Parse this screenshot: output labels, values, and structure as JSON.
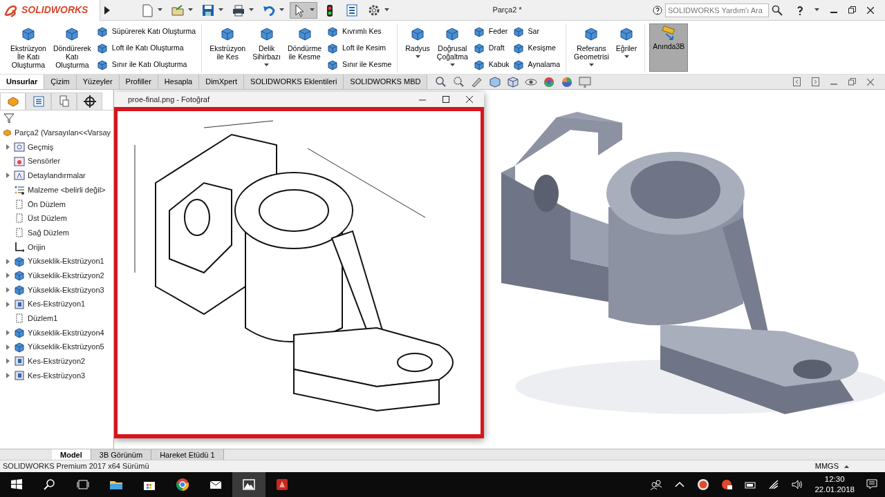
{
  "window": {
    "logo": "SOLIDWORKS",
    "title": "Parça2 *"
  },
  "quick_tools": [
    {
      "kind": "new",
      "pressed": false,
      "dropdown": true
    },
    {
      "kind": "open",
      "pressed": false,
      "dropdown": true
    },
    {
      "kind": "save",
      "pressed": false,
      "dropdown": true
    },
    {
      "kind": "print",
      "pressed": false,
      "dropdown": true
    },
    {
      "kind": "undo",
      "pressed": false,
      "dropdown": true
    },
    {
      "kind": "select",
      "pressed": true,
      "dropdown": true
    },
    {
      "kind": "rebuild",
      "pressed": false,
      "dropdown": false
    },
    {
      "kind": "list",
      "pressed": false,
      "dropdown": false
    },
    {
      "kind": "settings",
      "pressed": false,
      "dropdown": true
    }
  ],
  "help_search": {
    "placeholder": "SOLIDWORKS Yardım'ı Ara"
  },
  "ribbon": [
    {
      "items": [
        {
          "kind": "large",
          "label": "Ekstrüzyon\nİle Katı\nOluşturma",
          "dropdown": false
        },
        {
          "kind": "large",
          "label": "Döndürerek\nKatı\nOluşturma",
          "dropdown": false
        },
        {
          "kind": "stack",
          "items": [
            "Süpürerek Katı Oluşturma",
            "Loft ile Katı Oluşturma",
            "Sınır ile Katı Oluşturma"
          ]
        }
      ]
    },
    {
      "items": [
        {
          "kind": "large",
          "label": "Ekstrüzyon\nile Kes",
          "dropdown": false
        },
        {
          "kind": "large",
          "label": "Delik\nSihirbazı",
          "dropdown": true
        },
        {
          "kind": "large",
          "label": "Döndürme\nile Kesme",
          "dropdown": false
        },
        {
          "kind": "stack",
          "items": [
            "Kıvrımlı Kes",
            "Loft ile Kesim",
            "Sınır ile Kesme"
          ]
        }
      ]
    },
    {
      "items": [
        {
          "kind": "large",
          "label": "Radyus",
          "dropdown": true
        },
        {
          "kind": "large",
          "label": "Doğrusal\nÇoğaltma",
          "dropdown": true
        },
        {
          "kind": "stack",
          "items": [
            "Feder",
            "Draft",
            "Kabuk"
          ]
        },
        {
          "kind": "stack",
          "items": [
            "Sar",
            "Kesişme",
            "Aynalama"
          ]
        }
      ]
    },
    {
      "items": [
        {
          "kind": "large",
          "label": "Referans\nGeometrisi",
          "dropdown": true
        },
        {
          "kind": "large",
          "label": "Eğriler",
          "dropdown": true
        }
      ]
    }
  ],
  "instant3d": {
    "label": "Anında3B",
    "on": true
  },
  "command_tabs": [
    {
      "label": "Unsurlar",
      "selected": true
    },
    {
      "label": "Çizim",
      "selected": false
    },
    {
      "label": "Yüzeyler",
      "selected": false
    },
    {
      "label": "Profiller",
      "selected": false
    },
    {
      "label": "Hesapla",
      "selected": false
    },
    {
      "label": "DimXpert",
      "selected": false
    },
    {
      "label": "SOLIDWORKS Eklentileri",
      "selected": false
    },
    {
      "label": "SOLIDWORKS MBD",
      "selected": false
    }
  ],
  "panel_tabs": [
    {
      "kind": "feature",
      "selected": true
    },
    {
      "kind": "property",
      "selected": false
    },
    {
      "kind": "config",
      "selected": false
    },
    {
      "kind": "dim",
      "selected": false
    }
  ],
  "feature_tree": {
    "root": "Parça2  (Varsayılan<<Varsay",
    "children": [
      {
        "kind": "history",
        "label": "Geçmiş",
        "expandable": true
      },
      {
        "kind": "sensor",
        "label": "Sensörler",
        "expandable": false
      },
      {
        "kind": "annotation",
        "label": "Detaylandırmalar",
        "expandable": true
      },
      {
        "kind": "material",
        "label": "Malzeme <belirli değil>",
        "expandable": false
      },
      {
        "kind": "plane",
        "label": "Ön Düzlem",
        "expandable": false
      },
      {
        "kind": "plane",
        "label": "Üst Düzlem",
        "expandable": false
      },
      {
        "kind": "plane",
        "label": "Sağ Düzlem",
        "expandable": false
      },
      {
        "kind": "origin",
        "label": "Orijin",
        "expandable": false
      },
      {
        "kind": "extrude",
        "label": "Yükseklik-Ekstrüzyon1",
        "expandable": true
      },
      {
        "kind": "extrude",
        "label": "Yükseklik-Ekstrüzyon2",
        "expandable": true
      },
      {
        "kind": "extrude",
        "label": "Yükseklik-Ekstrüzyon3",
        "expandable": true
      },
      {
        "kind": "cut",
        "label": "Kes-Ekstrüzyon1",
        "expandable": true
      },
      {
        "kind": "plane",
        "label": "Düzlem1",
        "expandable": false
      },
      {
        "kind": "extrude",
        "label": "Yükseklik-Ekstrüzyon4",
        "expandable": true
      },
      {
        "kind": "extrude",
        "label": "Yükseklik-Ekstrüzyon5",
        "expandable": true
      },
      {
        "kind": "cut",
        "label": "Kes-Ekstrüzyon2",
        "expandable": true
      },
      {
        "kind": "cut",
        "label": "Kes-Ekstrüzyon3",
        "expandable": true
      }
    ]
  },
  "photo_window": {
    "title": "proe-final.png - Fotoğraf"
  },
  "bottom_tabs": [
    {
      "label": "Model",
      "selected": true
    },
    {
      "label": "3B Görünüm",
      "selected": false
    },
    {
      "label": "Hareket Etüdü 1",
      "selected": false
    }
  ],
  "status_bar": {
    "text": "SOLIDWORKS Premium 2017 x64 Sürümü",
    "units": "MMGS"
  },
  "taskbar": {
    "apps": [
      {
        "kind": "start",
        "active": false
      },
      {
        "kind": "search",
        "active": false
      },
      {
        "kind": "taskview",
        "active": false
      },
      {
        "kind": "folder",
        "active": false
      },
      {
        "kind": "store",
        "active": false
      },
      {
        "kind": "browser",
        "active": false
      },
      {
        "kind": "mail",
        "active": false
      },
      {
        "kind": "photos",
        "active": true
      },
      {
        "kind": "cad",
        "active": false
      }
    ],
    "time": "12:30",
    "date": "22.01.2018"
  }
}
